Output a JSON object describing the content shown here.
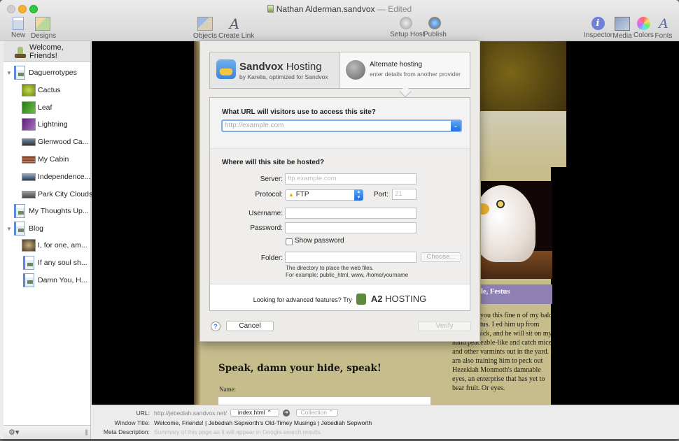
{
  "window": {
    "title": "Nathan Alderman.sandvox",
    "title_sep": "—",
    "edited": "Edited"
  },
  "toolbar": {
    "left": [
      {
        "label": "New",
        "icon": "new-page-icon"
      },
      {
        "label": "Designs",
        "icon": "designs-icon"
      }
    ],
    "center": [
      {
        "label": "Objects",
        "icon": "objects-icon"
      },
      {
        "label": "Create Link",
        "icon": "create-link-icon"
      },
      {
        "label": "Setup Host",
        "icon": "setup-host-icon"
      },
      {
        "label": "Publish",
        "icon": "publish-icon"
      }
    ],
    "right": [
      {
        "label": "Inspector",
        "icon": "inspector-icon"
      },
      {
        "label": "Media",
        "icon": "media-icon"
      },
      {
        "label": "Colors",
        "icon": "colors-icon"
      },
      {
        "label": "Fonts",
        "icon": "fonts-icon"
      }
    ]
  },
  "sidebar": {
    "home": "Welcome, Friends!",
    "items": [
      {
        "label": "Daguerrotypes",
        "type": "collection",
        "expanded": true
      },
      {
        "label": "Cactus",
        "type": "photo"
      },
      {
        "label": "Leaf",
        "type": "photo"
      },
      {
        "label": "Lightning",
        "type": "photo"
      },
      {
        "label": "Glenwood Ca...",
        "type": "photo"
      },
      {
        "label": "My Cabin",
        "type": "photo"
      },
      {
        "label": "Independence...",
        "type": "photo"
      },
      {
        "label": "Park City Clouds",
        "type": "photo"
      },
      {
        "label": "My Thoughts Up...",
        "type": "page"
      },
      {
        "label": "Blog",
        "type": "collection",
        "expanded": true
      },
      {
        "label": "I, for one, am...",
        "type": "photo"
      },
      {
        "label": "If any soul sh...",
        "type": "page"
      },
      {
        "label": "Damn You, H...",
        "type": "page"
      }
    ],
    "action_icon": "gear-icon"
  },
  "page_preview": {
    "caption": "le, Festus",
    "body_text": "hare with you this fine n of my bald eagle, Festus. I ed him up from when he hick, and he will sit on my hand peaceable-like and catch mice and other varmints out in the yard. I am also training him to peck out Hezekiah Monmoth's damnable eyes, an enterprise that has yet to bear fruit. Or eyes.",
    "heading": "Speak, damn your hide, speak!",
    "name_label": "Name:"
  },
  "host_sheet": {
    "sandvox": {
      "title_bold": "Sandvox",
      "title_rest": " Hosting",
      "subtitle": "by Karelia, optimized for Sandvox"
    },
    "alternate": {
      "title": "Alternate hosting",
      "subtitle": "enter details from another provider",
      "selected": true
    },
    "url_question": "What URL will visitors use to access this site?",
    "url_placeholder": "http://example.com",
    "where_question": "Where will this site be hosted?",
    "server_label": "Server:",
    "server_placeholder": "ftp.example.com",
    "protocol_label": "Protocol:",
    "protocol_value": "FTP",
    "port_label": "Port:",
    "port_placeholder": "21",
    "username_label": "Username:",
    "username_value": "",
    "password_label": "Password:",
    "password_value": "",
    "show_password_label": "Show password",
    "show_password_checked": false,
    "folder_label": "Folder:",
    "folder_value": "",
    "choose_label": "Choose...",
    "folder_hint_1": "The directory to place the web files.",
    "folder_hint_2": "For example: public_html, www, /home/yourname",
    "advanced_text": "Looking for advanced features? Try",
    "a2_bold": "A2",
    "a2_rest": " HOSTING",
    "help_label": "?",
    "cancel_label": "Cancel",
    "verify_label": "Verify"
  },
  "page_meta": {
    "url_label": "URL:",
    "url_base": "http://jebediah.sandvox.net/",
    "url_file": "index.html",
    "collection_label": "Collection",
    "window_title_label": "Window Title:",
    "window_title_value": "Welcome, Friends! | Jebediah Sepworth's Old-Timey Musings | Jebediah Sepworth",
    "meta_desc_label": "Meta Description:",
    "meta_desc_placeholder": "Summary of this page as it will appear in Google search results."
  }
}
